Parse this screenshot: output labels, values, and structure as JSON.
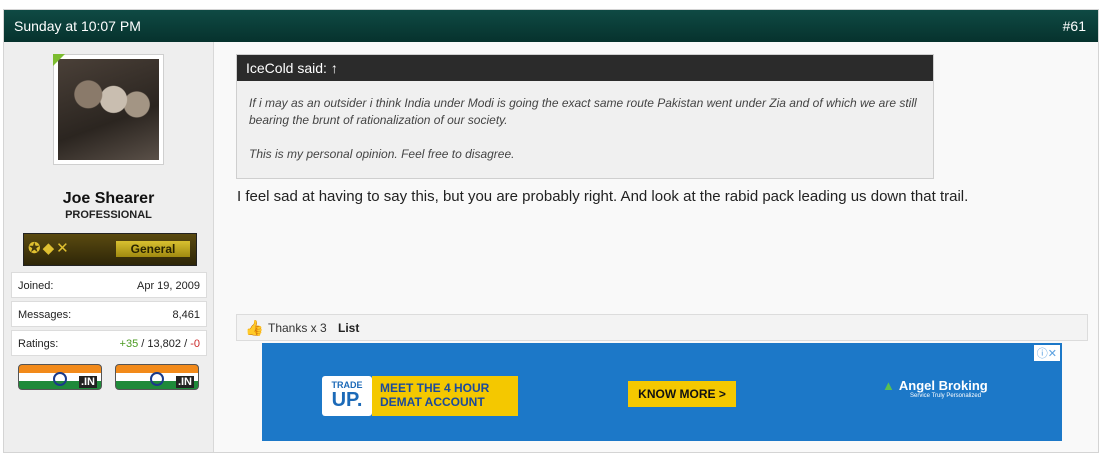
{
  "header": {
    "date": "Sunday at 10:07 PM",
    "post_number": "#61"
  },
  "user": {
    "name": "Joe Shearer",
    "title": "PROFESSIONAL",
    "rank_label": "General",
    "stats": [
      {
        "label": "Joined:",
        "value": "Apr 19, 2009"
      },
      {
        "label": "Messages:",
        "value": "8,461"
      }
    ],
    "ratings": {
      "label": "Ratings:",
      "positive": "+35",
      "sep1": " / ",
      "total": "13,802",
      "sep2": " / ",
      "negative": "-0"
    },
    "flags": [
      ".IN",
      ".IN"
    ]
  },
  "quote": {
    "author": "IceCold said: ↑",
    "lines": [
      "If i may as an outsider i think India under Modi is going the exact same route Pakistan went under Zia and of which we are still bearing the brunt of rationalization of our society.",
      "This is my personal opinion. Feel free to disagree."
    ]
  },
  "message": "I feel sad at having to say this, but you are probably right. And look at the rabid pack leading us down that trail.",
  "actions": {
    "thanks": "Thanks x 3",
    "list": "List"
  },
  "ad": {
    "trade_top": "TRADE",
    "trade_bottom": "UP.",
    "meet_line1": "MEET THE 4 HOUR",
    "meet_line2": "DEMAT ACCOUNT",
    "cta": "KNOW MORE >",
    "brand": "Angel Broking",
    "brand_sub": "Service Truly Personalized",
    "icons": "ⓘ✕"
  },
  "colors": {
    "header_bg": "#06322d",
    "positive": "#4a9a20",
    "negative": "#cc2a2a",
    "ad_bg": "#1c78c8"
  }
}
